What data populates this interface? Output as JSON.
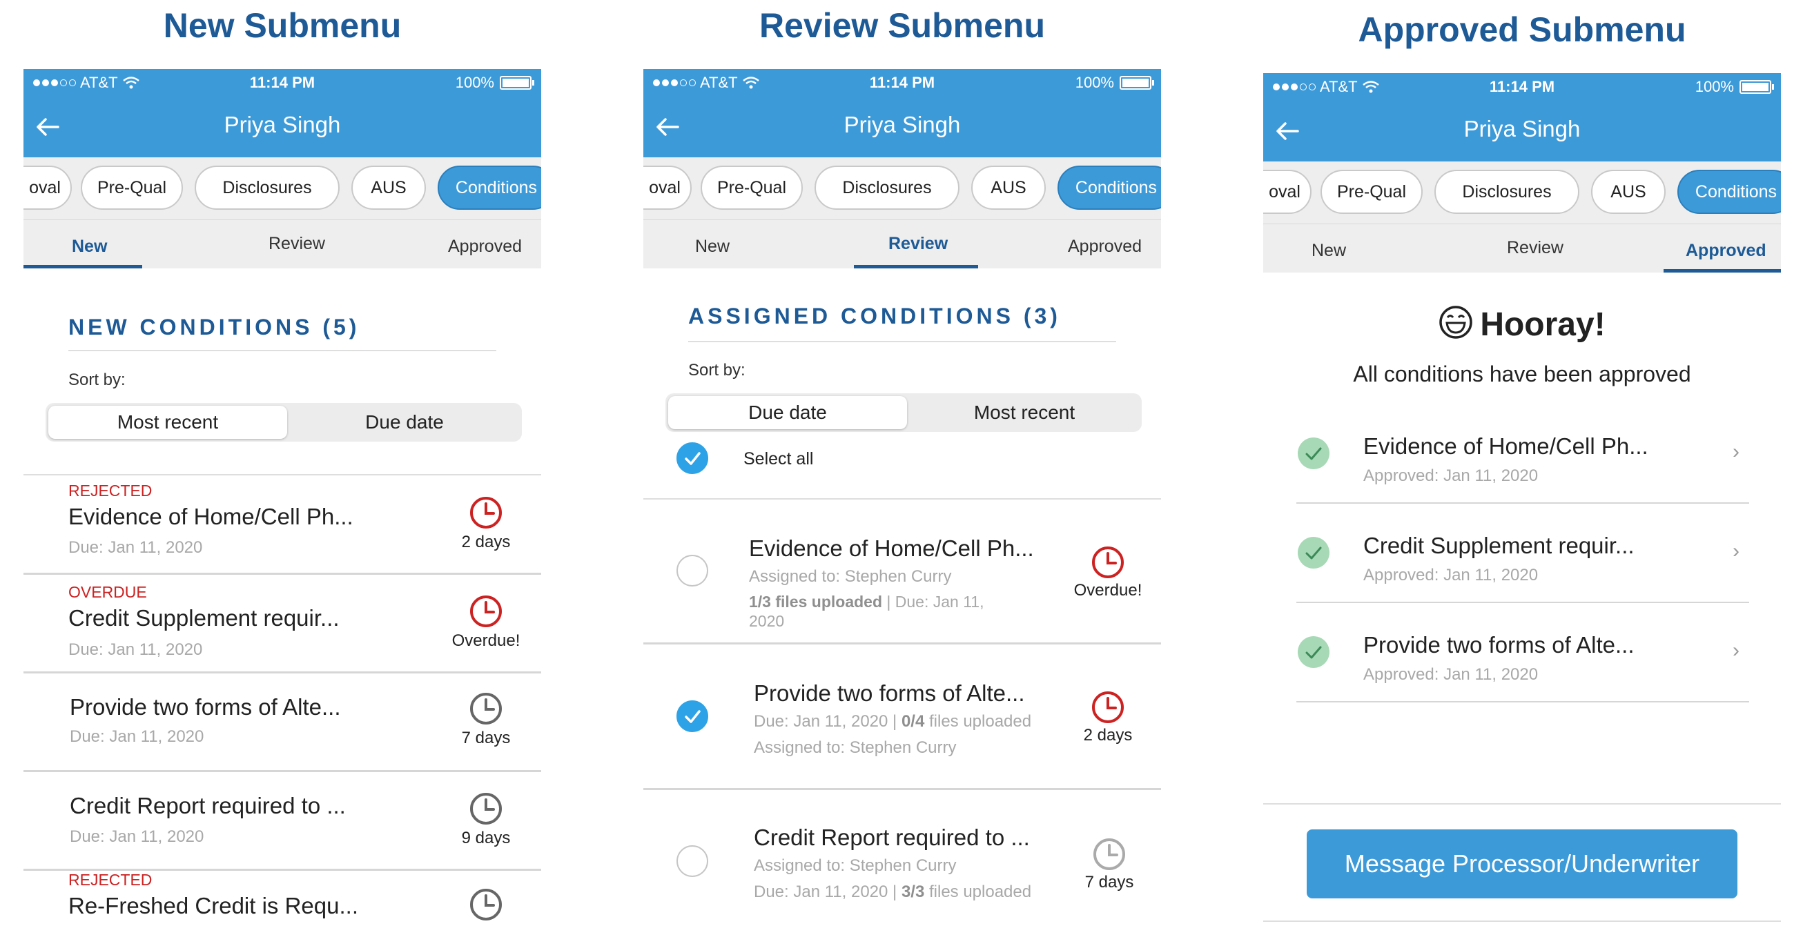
{
  "status": {
    "carrier": "AT&T",
    "time": "11:14 PM",
    "battery": "100%"
  },
  "nav": {
    "name": "Priya Singh"
  },
  "chips": [
    "oval",
    "Pre-Qual",
    "Disclosures",
    "AUS",
    "Conditions"
  ],
  "tabs": [
    "New",
    "Review",
    "Approved"
  ],
  "new_panel": {
    "heading": "New Submenu",
    "section": "NEW CONDITIONS (5)",
    "sort_by": "Sort by:",
    "sort_options": [
      "Most recent",
      "Due date"
    ],
    "items": [
      {
        "tag": "REJECTED",
        "title": "Evidence of Home/Cell Ph...",
        "due": "Due: Jan 11, 2020",
        "time": "2 days",
        "urgent": true
      },
      {
        "tag": "OVERDUE",
        "title": "Credit Supplement requir...",
        "due": "Due: Jan 11, 2020",
        "time": "Overdue!",
        "urgent": true
      },
      {
        "tag": "",
        "title": "Provide two forms of Alte...",
        "due": "Due: Jan 11, 2020",
        "time": "7 days",
        "urgent": false
      },
      {
        "tag": "",
        "title": "Credit Report required to ...",
        "due": "Due: Jan 11, 2020",
        "time": "9 days",
        "urgent": false
      },
      {
        "tag": "REJECTED",
        "title": "Re-Freshed Credit is Requ...",
        "due": "",
        "time": "",
        "urgent": false
      }
    ]
  },
  "review_panel": {
    "heading": "Review Submenu",
    "section": "ASSIGNED CONDITIONS (3)",
    "sort_by": "Sort by:",
    "sort_options": [
      "Due date",
      "Most recent"
    ],
    "select_all": "Select all",
    "items": [
      {
        "title": "Evidence of Home/Cell Ph...",
        "line1": "Assigned to: Stephen Curry",
        "files_bold": "1/3 files uploaded",
        "line2_rest": " | Due: Jan 11,",
        "line3": "2020",
        "time": "Overdue!",
        "checked": false,
        "clock": "red"
      },
      {
        "title": "Provide two forms of Alte...",
        "line1_pre": "Due: Jan 11, 2020 | ",
        "files_bold": "0/4",
        "line1_post": " files uploaded",
        "line2": "Assigned to: Stephen Curry",
        "time": "2 days",
        "checked": true,
        "clock": "red"
      },
      {
        "title": "Credit Report required to ...",
        "line1": "Assigned to: Stephen Curry",
        "line2_pre": "Due: Jan 11, 2020 | ",
        "files_bold": "3/3",
        "line2_post": " files uploaded",
        "time": "7 days",
        "checked": false,
        "clock": "grey"
      }
    ]
  },
  "approved_panel": {
    "heading": "Approved Submenu",
    "hooray": "Hooray!",
    "message": "All conditions have been approved",
    "items": [
      {
        "title": "Evidence of Home/Cell Ph...",
        "sub": "Approved: Jan 11, 2020"
      },
      {
        "title": "Credit Supplement requir...",
        "sub": "Approved: Jan 11, 2020"
      },
      {
        "title": "Provide two forms of Alte...",
        "sub": "Approved: Jan 11, 2020"
      }
    ],
    "button": "Message Processor/Underwriter"
  },
  "colors": {
    "brand_blue": "#3d9ad9",
    "navy": "#1d5a96",
    "red": "#cc2222",
    "grey": "#666666",
    "green_check": "#a7d9b6"
  }
}
